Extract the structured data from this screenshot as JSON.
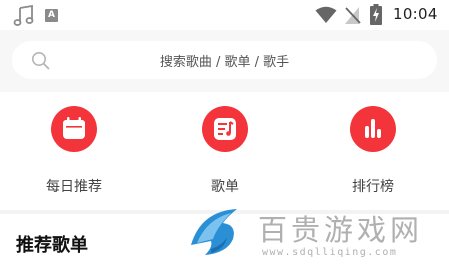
{
  "status_bar": {
    "time": "10:04",
    "notification_badge": "A",
    "icons": [
      "music-note-icon",
      "app-badge-icon",
      "wifi-icon",
      "no-signal-icon",
      "battery-charging-icon"
    ]
  },
  "search": {
    "placeholder": "搜索歌曲 / 歌单 / 歌手",
    "icon": "search-icon"
  },
  "entries": [
    {
      "label": "每日推荐",
      "icon": "calendar-icon"
    },
    {
      "label": "歌单",
      "icon": "playlist-icon"
    },
    {
      "label": "排行榜",
      "icon": "chart-icon"
    }
  ],
  "section": {
    "title": "推荐歌单"
  },
  "watermark": {
    "text": "百贵游戏网",
    "url": "www.sdqlliqing.com"
  },
  "colors": {
    "accent": "#f4343b",
    "background": "#f7f7f7"
  }
}
